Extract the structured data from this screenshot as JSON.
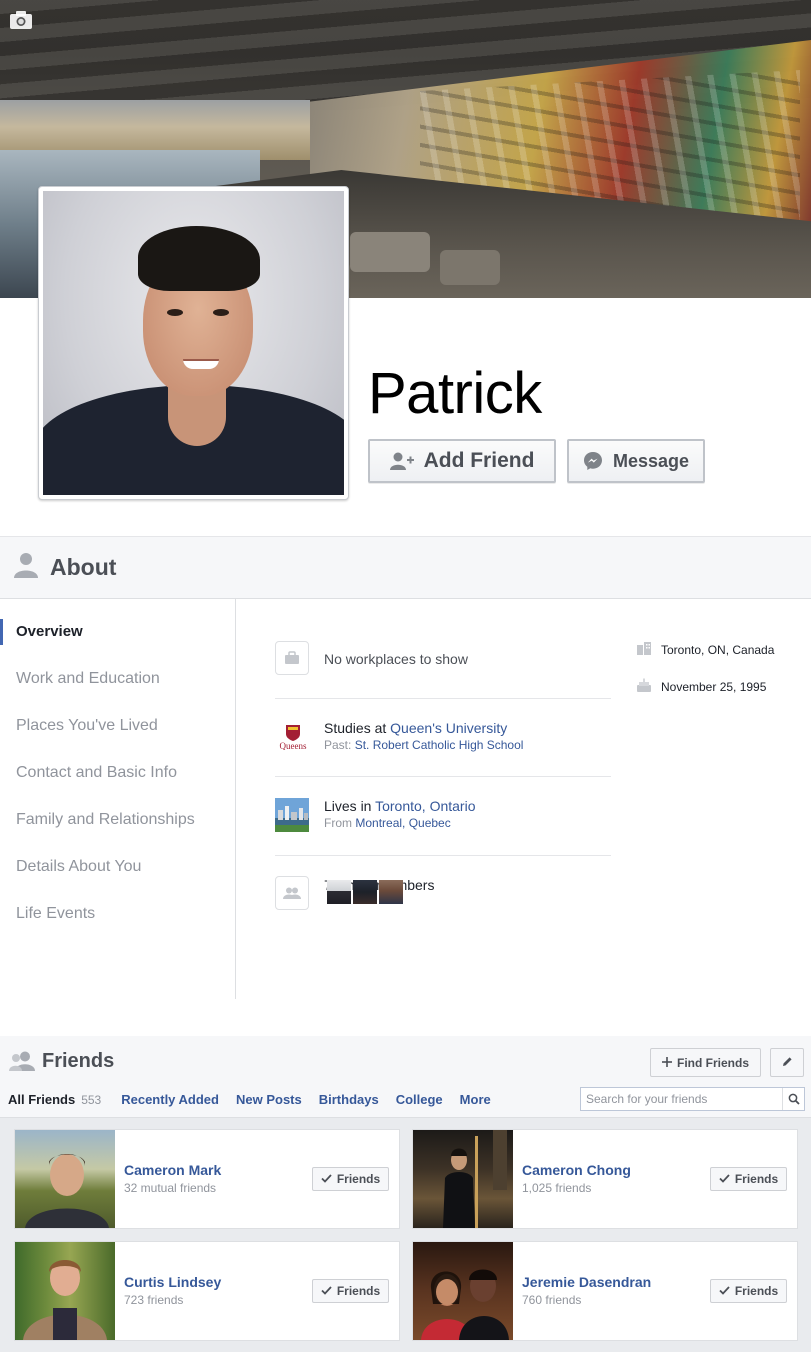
{
  "profile": {
    "name": "Patrick",
    "add_friend_label": "Add Friend",
    "message_label": "Message"
  },
  "about": {
    "title": "About",
    "nav": [
      {
        "label": "Overview",
        "active": true
      },
      {
        "label": "Work and Education"
      },
      {
        "label": "Places You've Lived"
      },
      {
        "label": "Contact and Basic Info"
      },
      {
        "label": "Family and Relationships"
      },
      {
        "label": "Details About You"
      },
      {
        "label": "Life Events"
      }
    ],
    "work": {
      "text": "No workplaces to show",
      "icon": "briefcase-icon"
    },
    "education": {
      "prefix": "Studies at ",
      "school": "Queen's University",
      "logo_text": "Queens",
      "past_prefix": "Past: ",
      "past_school": "St. Robert Catholic High School"
    },
    "lives": {
      "prefix": "Lives in ",
      "city": "Toronto, Ontario",
      "from_prefix": "From ",
      "from_city": "Montreal, Quebec"
    },
    "family": {
      "text": "7 family members",
      "icon": "people-icon"
    },
    "side": {
      "location": "Toronto, ON, Canada",
      "location_icon": "building-icon",
      "birthday": "November 25, 1995",
      "birthday_icon": "cake-icon"
    }
  },
  "friends": {
    "title": "Friends",
    "find_friends_label": "Find Friends",
    "tabs": {
      "all_label": "All Friends",
      "all_count": "553",
      "recent": "Recently Added",
      "new_posts": "New Posts",
      "birthdays": "Birthdays",
      "college": "College",
      "more": "More"
    },
    "search_placeholder": "Search for your friends",
    "button_label": "Friends",
    "list": [
      {
        "name": "Cameron Mark",
        "meta": "32 mutual friends"
      },
      {
        "name": "Cameron Chong",
        "meta": "1,025 friends"
      },
      {
        "name": "Curtis Lindsey",
        "meta": "723 friends"
      },
      {
        "name": "Jeremie Dasendran",
        "meta": "760 friends"
      }
    ]
  },
  "colors": {
    "link": "#365899",
    "accent": "#4267b2",
    "muted_text": "#90949c",
    "header_bg": "#f6f7f9"
  }
}
